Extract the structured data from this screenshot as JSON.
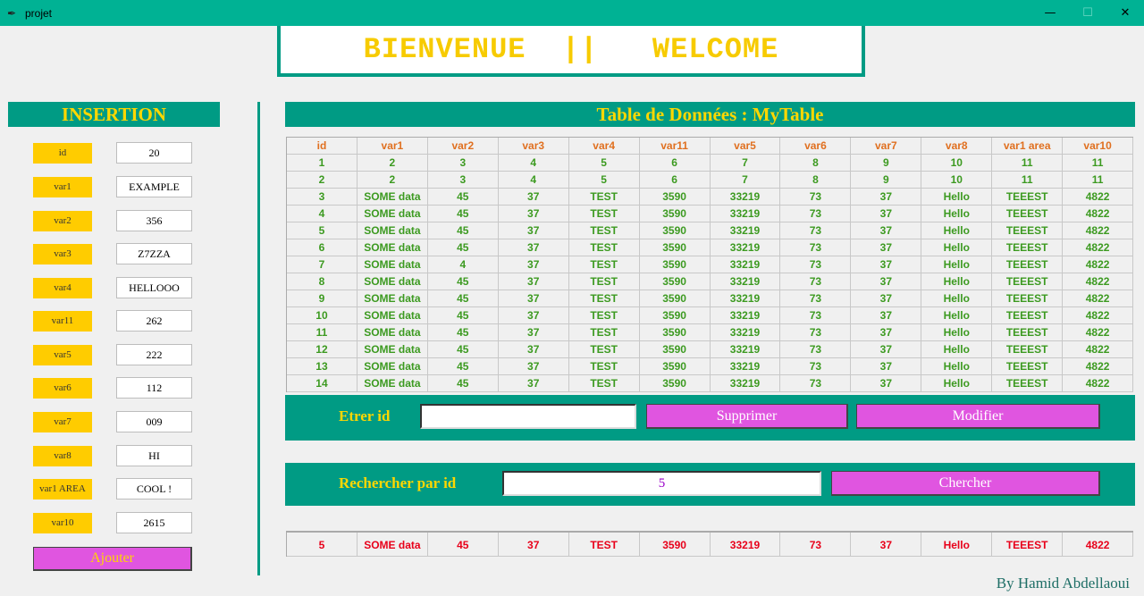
{
  "window": {
    "title": "projet",
    "app_icon": "feather-icon"
  },
  "banner": {
    "text": "BIENVENUE  ||   WELCOME"
  },
  "insertion": {
    "title": "INSERTION",
    "fields": [
      {
        "label": "id",
        "value": "20"
      },
      {
        "label": "var1",
        "value": "EXAMPLE"
      },
      {
        "label": "var2",
        "value": "356"
      },
      {
        "label": "var3",
        "value": "Z7ZZA"
      },
      {
        "label": "var4",
        "value": "HELLOOO"
      },
      {
        "label": "var11",
        "value": "262"
      },
      {
        "label": "var5",
        "value": "222"
      },
      {
        "label": "var6",
        "value": "112"
      },
      {
        "label": "var7",
        "value": "009"
      },
      {
        "label": "var8",
        "value": "HI"
      },
      {
        "label": "var1 AREA",
        "value": "COOL !"
      },
      {
        "label": "var10",
        "value": "2615"
      }
    ],
    "add_button": "Ajouter"
  },
  "table": {
    "title": "Table de Données : MyTable",
    "columns": [
      "id",
      "var1",
      "var2",
      "var3",
      "var4",
      "var11",
      "var5",
      "var6",
      "var7",
      "var8",
      "var1 area",
      "var10"
    ],
    "rows": [
      [
        "1",
        "2",
        "3",
        "4",
        "5",
        "6",
        "7",
        "8",
        "9",
        "10",
        "11",
        "11"
      ],
      [
        "2",
        "2",
        "3",
        "4",
        "5",
        "6",
        "7",
        "8",
        "9",
        "10",
        "11",
        "11"
      ],
      [
        "3",
        "SOME data",
        "45",
        "37",
        "TEST",
        "3590",
        "33219",
        "73",
        "37",
        "Hello",
        "TEEEST",
        "4822"
      ],
      [
        "4",
        "SOME data",
        "45",
        "37",
        "TEST",
        "3590",
        "33219",
        "73",
        "37",
        "Hello",
        "TEEEST",
        "4822"
      ],
      [
        "5",
        "SOME data",
        "45",
        "37",
        "TEST",
        "3590",
        "33219",
        "73",
        "37",
        "Hello",
        "TEEEST",
        "4822"
      ],
      [
        "6",
        "SOME data",
        "45",
        "37",
        "TEST",
        "3590",
        "33219",
        "73",
        "37",
        "Hello",
        "TEEEST",
        "4822"
      ],
      [
        "7",
        "SOME data",
        "4",
        "37",
        "TEST",
        "3590",
        "33219",
        "73",
        "37",
        "Hello",
        "TEEEST",
        "4822"
      ],
      [
        "8",
        "SOME data",
        "45",
        "37",
        "TEST",
        "3590",
        "33219",
        "73",
        "37",
        "Hello",
        "TEEEST",
        "4822"
      ],
      [
        "9",
        "SOME data",
        "45",
        "37",
        "TEST",
        "3590",
        "33219",
        "73",
        "37",
        "Hello",
        "TEEEST",
        "4822"
      ],
      [
        "10",
        "SOME data",
        "45",
        "37",
        "TEST",
        "3590",
        "33219",
        "73",
        "37",
        "Hello",
        "TEEEST",
        "4822"
      ],
      [
        "11",
        "SOME data",
        "45",
        "37",
        "TEST",
        "3590",
        "33219",
        "73",
        "37",
        "Hello",
        "TEEEST",
        "4822"
      ],
      [
        "12",
        "SOME data",
        "45",
        "37",
        "TEST",
        "3590",
        "33219",
        "73",
        "37",
        "Hello",
        "TEEEST",
        "4822"
      ],
      [
        "13",
        "SOME data",
        "45",
        "37",
        "TEST",
        "3590",
        "33219",
        "73",
        "37",
        "Hello",
        "TEEEST",
        "4822"
      ],
      [
        "14",
        "SOME data",
        "45",
        "37",
        "TEST",
        "3590",
        "33219",
        "73",
        "37",
        "Hello",
        "TEEEST",
        "4822"
      ]
    ]
  },
  "delete_panel": {
    "label": "Etrer id",
    "input_value": "",
    "delete_button": "Supprimer",
    "modify_button": "Modifier"
  },
  "search_panel": {
    "label": "Rechercher par id",
    "input_value": "5",
    "search_button": "Chercher"
  },
  "search_result": [
    "5",
    "SOME data",
    "45",
    "37",
    "TEST",
    "3590",
    "33219",
    "73",
    "37",
    "Hello",
    "TEEEST",
    "4822"
  ],
  "credit": "By Hamid Abdellaoui",
  "colors": {
    "teal": "#009b84",
    "titlebar": "#00b294",
    "gold": "#ffd700",
    "label_bg": "#ffcc00",
    "button": "#e055e0",
    "result_text": "#e8001a",
    "row_text": "#3c9a20",
    "header_text": "#e07020"
  }
}
